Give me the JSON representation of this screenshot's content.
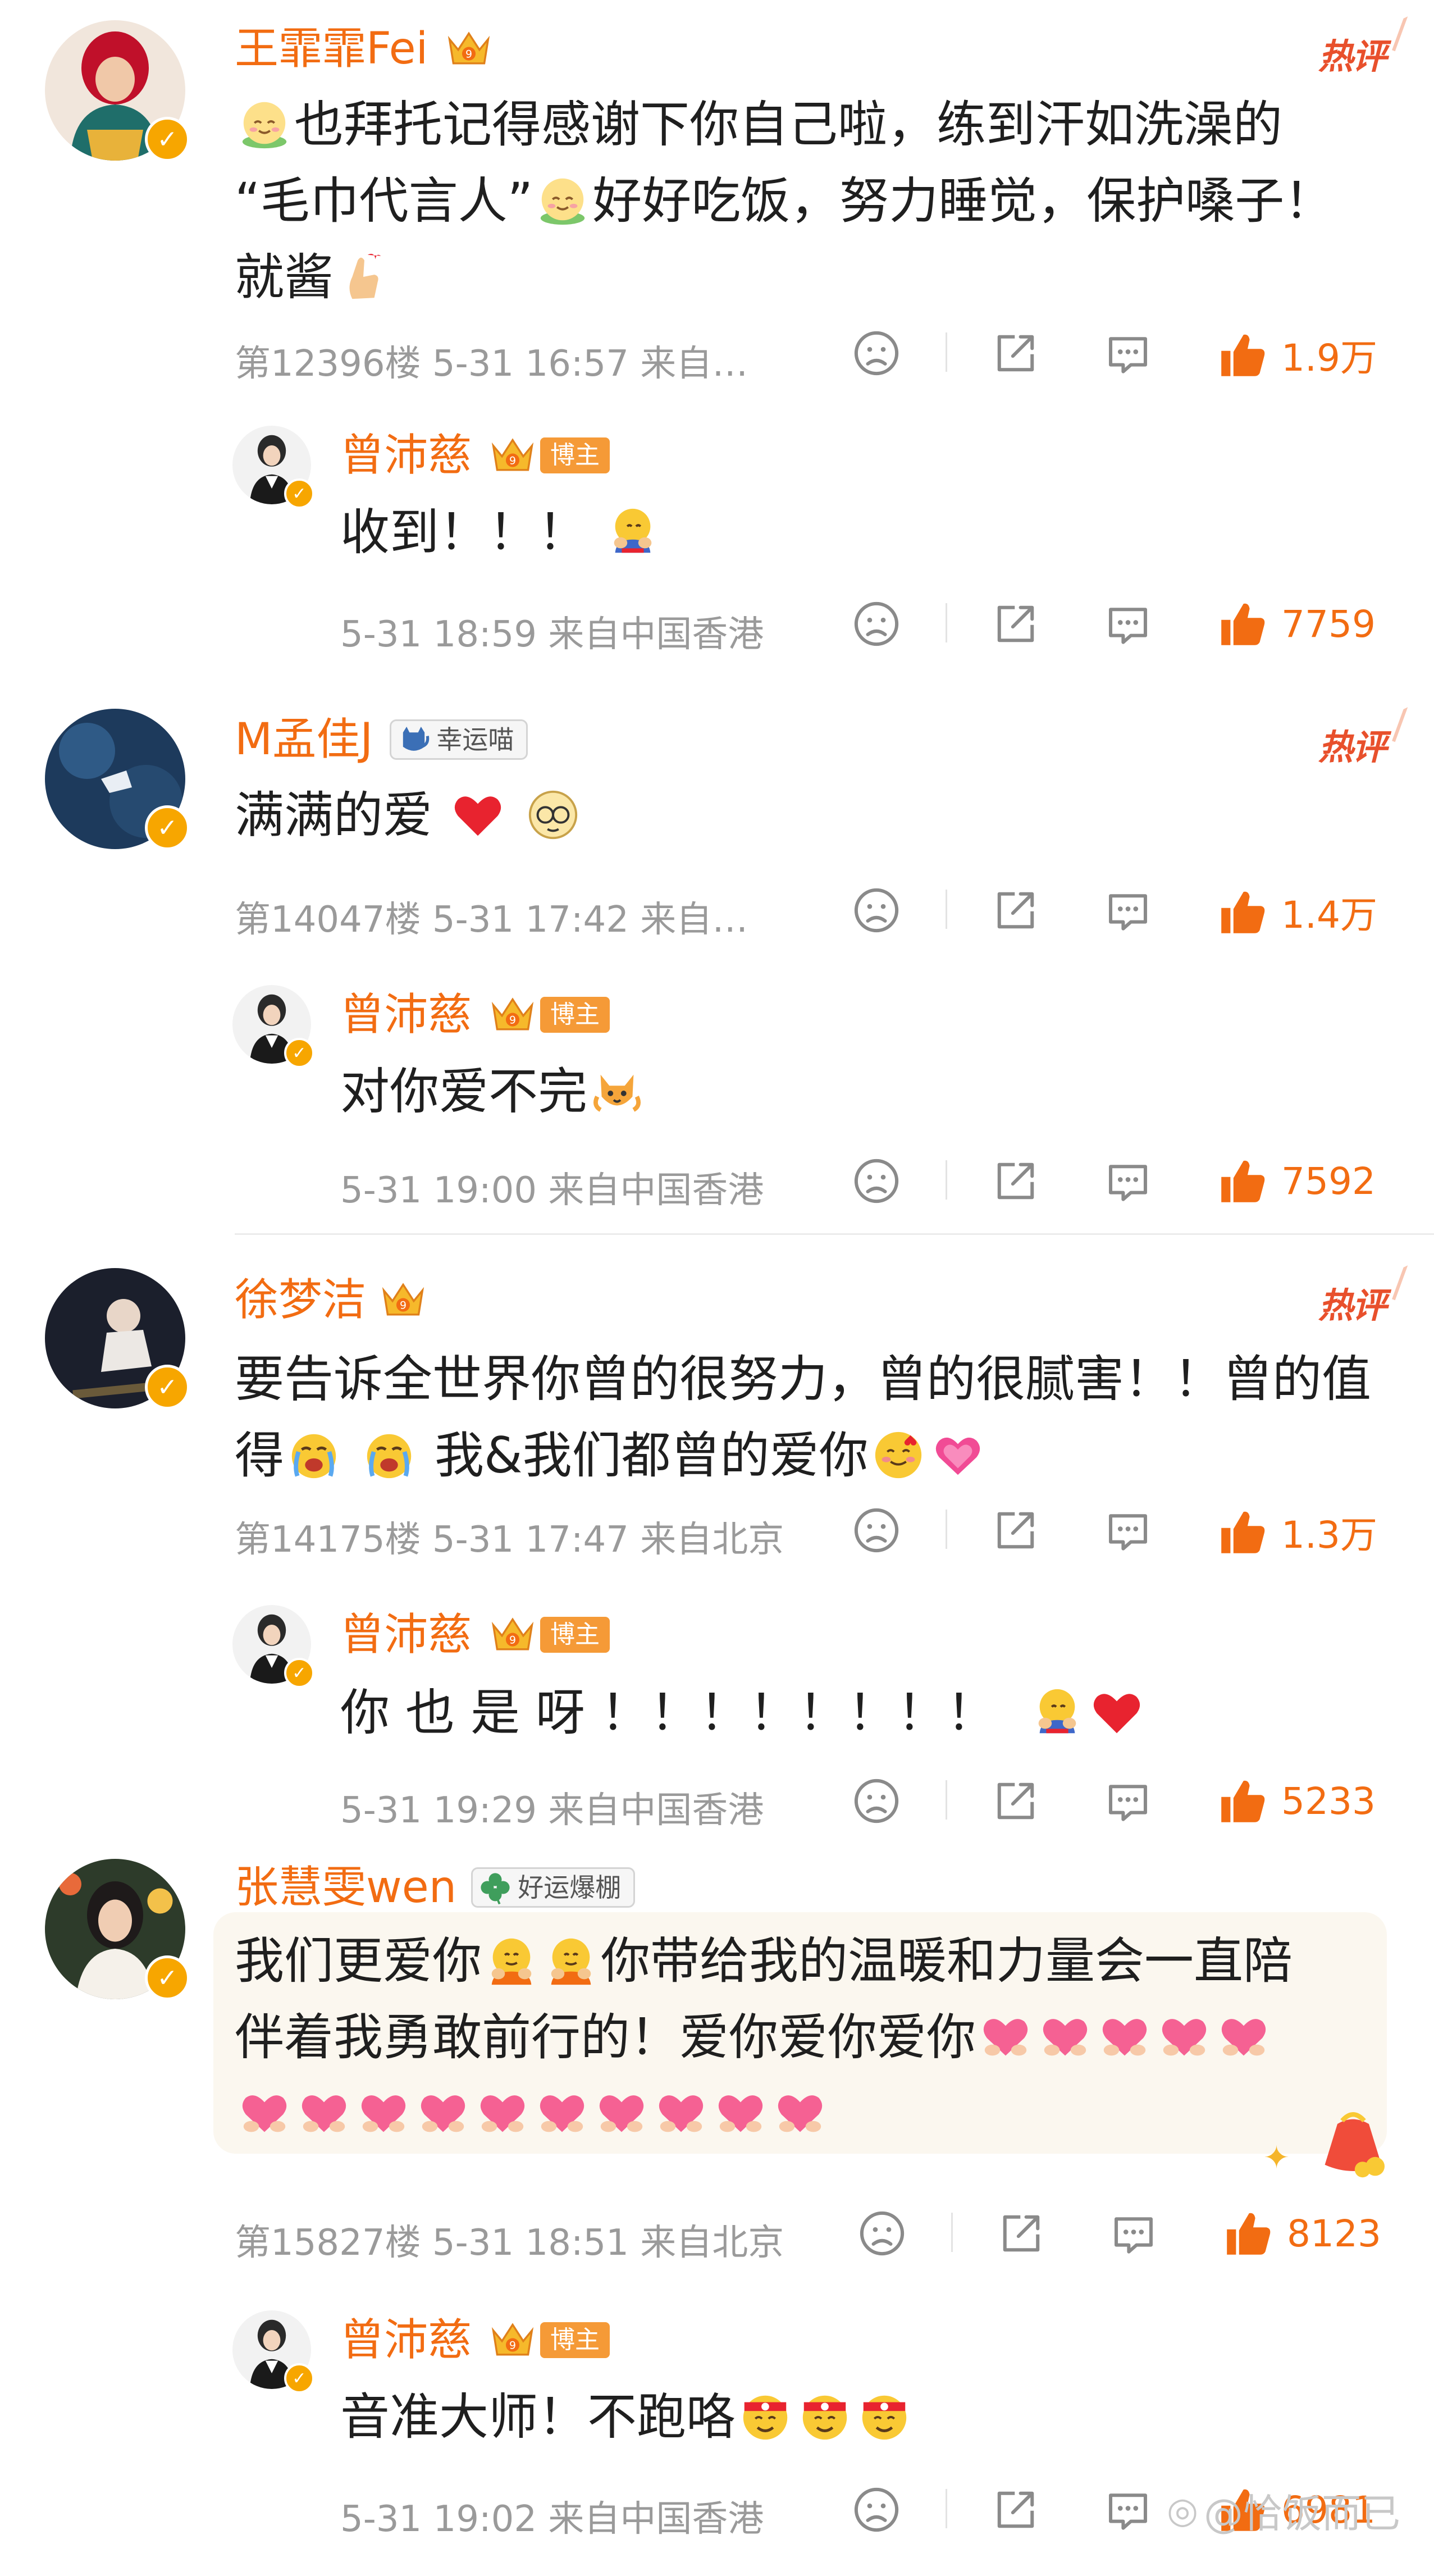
{
  "colors": {
    "accent": "#f26c12",
    "hot": "#e8502c",
    "meta": "#9a9a9a",
    "blogger_badge": "#f59a37",
    "verified": "#f7a600"
  },
  "comments": [
    {
      "author": "王霏霏Fei",
      "hot": "热评",
      "text_line1": "也拜托记得感谢下你自己啦，练到汗如洗澡的",
      "text_line2": "“毛巾代言人”",
      "text_line2b": "好好吃饭，努力睡觉，保护嗓子！",
      "text_line3": "就酱",
      "floor_meta": "第12396楼 5-31 16:57 来自…",
      "likes": "1.9万",
      "reply": {
        "author": "曾沛慈",
        "badge": "博主",
        "text": "收到！！！",
        "meta": "5-31 18:59 来自中国香港",
        "likes": "7759"
      }
    },
    {
      "author": "M孟佳J",
      "tag": "幸运喵",
      "hot": "热评",
      "text": "满满的爱",
      "floor_meta": "第14047楼 5-31 17:42 来自…",
      "likes": "1.4万",
      "reply": {
        "author": "曾沛慈",
        "badge": "博主",
        "text": "对你爱不完",
        "meta": "5-31 19:00 来自中国香港",
        "likes": "7592"
      }
    },
    {
      "author": "徐梦洁",
      "hot": "热评",
      "text_line1": "要告诉全世界你曾的很努力，曾的很腻害！！曾的值",
      "text_line2a": "得",
      "text_line2b": "我&我们都曾的爱你",
      "floor_meta": "第14175楼 5-31 17:47 来自北京",
      "likes": "1.3万",
      "reply": {
        "author": "曾沛慈",
        "badge": "博主",
        "text": "你 也 是 呀 ！！！！！！！！",
        "meta": "5-31 19:29 来自中国香港",
        "likes": "5233"
      }
    },
    {
      "author": "张慧雯wen",
      "tag": "好运爆棚",
      "text_line1a": "我们更爱你",
      "text_line1b": "你带给我的温暖和力量会一直陪",
      "text_line2": "伴着我勇敢前行的！爱你爱你爱你",
      "floor_meta": "第15827楼 5-31 18:51 来自北京",
      "likes": "8123",
      "reply": {
        "author": "曾沛慈",
        "badge": "博主",
        "text": "音准大师！不跑咯",
        "meta": "5-31 19:02 来自中国香港",
        "likes": "6981"
      }
    }
  ],
  "watermark": "@恰饭而已",
  "icons": [
    "sad-face-icon",
    "share-icon",
    "comment-icon",
    "thumb-up-icon",
    "crown-icon",
    "verified-icon",
    "cat-icon",
    "clover-icon"
  ]
}
